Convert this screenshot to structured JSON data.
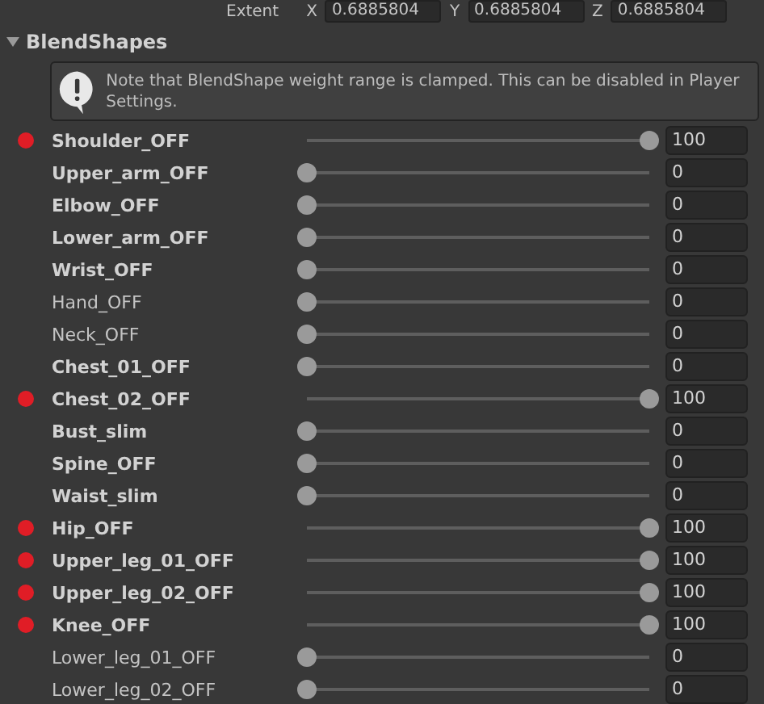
{
  "extent": {
    "label": "Extent",
    "fields": [
      {
        "axis": "X",
        "value": "0.6885804"
      },
      {
        "axis": "Y",
        "value": "0.6885804"
      },
      {
        "axis": "Z",
        "value": "0.6885804"
      }
    ]
  },
  "section": {
    "title": "BlendShapes",
    "expanded": true
  },
  "help": {
    "text": "Note that BlendShape weight range is clamped. This can be disabled in Player Settings."
  },
  "blendshapes": [
    {
      "name": "Shoulder_OFF",
      "keyed": true,
      "modified": true,
      "level": 1,
      "value": "100"
    },
    {
      "name": "Upper_arm_OFF",
      "keyed": false,
      "modified": true,
      "level": 0,
      "value": "0"
    },
    {
      "name": "Elbow_OFF",
      "keyed": false,
      "modified": true,
      "level": 0,
      "value": "0"
    },
    {
      "name": "Lower_arm_OFF",
      "keyed": false,
      "modified": true,
      "level": 0,
      "value": "0"
    },
    {
      "name": "Wrist_OFF",
      "keyed": false,
      "modified": true,
      "level": 0,
      "value": "0"
    },
    {
      "name": "Hand_OFF",
      "keyed": false,
      "modified": false,
      "level": 0,
      "value": "0"
    },
    {
      "name": "Neck_OFF",
      "keyed": false,
      "modified": false,
      "level": 0,
      "value": "0"
    },
    {
      "name": "Chest_01_OFF",
      "keyed": false,
      "modified": true,
      "level": 0,
      "value": "0"
    },
    {
      "name": "Chest_02_OFF",
      "keyed": true,
      "modified": true,
      "level": 1,
      "value": "100"
    },
    {
      "name": "Bust_slim",
      "keyed": false,
      "modified": true,
      "level": 0,
      "value": "0"
    },
    {
      "name": "Spine_OFF",
      "keyed": false,
      "modified": true,
      "level": 0,
      "value": "0"
    },
    {
      "name": "Waist_slim",
      "keyed": false,
      "modified": true,
      "level": 0,
      "value": "0"
    },
    {
      "name": "Hip_OFF",
      "keyed": true,
      "modified": true,
      "level": 1,
      "value": "100"
    },
    {
      "name": "Upper_leg_01_OFF",
      "keyed": true,
      "modified": true,
      "level": 1,
      "value": "100"
    },
    {
      "name": "Upper_leg_02_OFF",
      "keyed": true,
      "modified": true,
      "level": 1,
      "value": "100"
    },
    {
      "name": "Knee_OFF",
      "keyed": true,
      "modified": true,
      "level": 1,
      "value": "100"
    },
    {
      "name": "Lower_leg_01_OFF",
      "keyed": false,
      "modified": false,
      "level": 0,
      "value": "0"
    },
    {
      "name": "Lower_leg_02_OFF",
      "keyed": false,
      "modified": false,
      "level": 0,
      "value": "0"
    }
  ]
}
